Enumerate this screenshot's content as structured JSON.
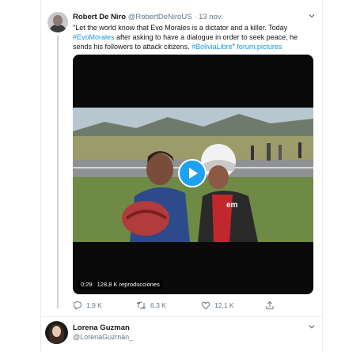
{
  "tweet": {
    "author_name": "Robert De Niro",
    "author_handle": "@RobertDeNiroUS",
    "separator": "·",
    "date": "13 nov.",
    "text_part1": "\"Let the world know that Evo Morales is a dictator and a killer. Today",
    "hashtag1": "#EvoMorales",
    "text_part2": " after asking to have a dialogue in order to seek peace, he sends his followers to attack citizens. ",
    "hashtag2": "#BoliviaLibre",
    "text_part3": "\" ",
    "link": "forum.pictures"
  },
  "video": {
    "duration": "0:29",
    "views": "128,8 K reproducciones",
    "overlay_text": "em"
  },
  "actions": {
    "replies": "1,9 K",
    "retweets": "6,3 K",
    "likes": "12,1 K"
  },
  "reply": {
    "author_name": "Lorena Guzman",
    "author_handle": "@LorenaGuzman_"
  },
  "icons": [
    "user-avatar",
    "chevron-down-icon",
    "play-icon",
    "reply-icon",
    "retweet-icon",
    "like-icon",
    "share-icon"
  ],
  "colors": {
    "link": "#1b95e0",
    "play_button": "#1da1f2",
    "muted": "#657786"
  }
}
